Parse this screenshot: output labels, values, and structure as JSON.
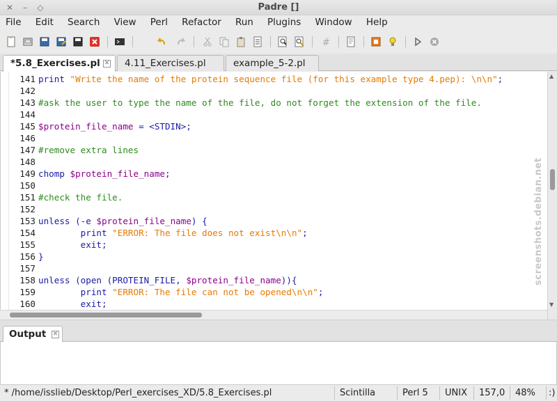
{
  "window": {
    "title": "Padre []",
    "close_glyph": "✕",
    "minimize_glyph": "–",
    "maximize_glyph": "◇"
  },
  "menu": [
    "File",
    "Edit",
    "Search",
    "View",
    "Perl",
    "Refactor",
    "Run",
    "Plugins",
    "Window",
    "Help"
  ],
  "toolbar": {
    "icons": [
      "new-file-icon",
      "open-file-icon",
      "save-icon",
      "save-as-icon",
      "save-all-icon",
      "close-file-icon",
      "command-line-icon",
      "undo-icon",
      "redo-icon",
      "cut-icon",
      "copy-icon",
      "paste-icon",
      "select-all-icon",
      "find-icon",
      "find-replace-icon",
      "comment-icon",
      "doc-stats-icon",
      "open-resource-icon",
      "tip-icon",
      "run-icon",
      "stop-icon"
    ]
  },
  "tabs": [
    {
      "label": "*5.8_Exercises.pl",
      "active": true
    },
    {
      "label": "4.11_Exercises.pl",
      "active": false
    },
    {
      "label": "example_5-2.pl",
      "active": false
    }
  ],
  "editor": {
    "lines": [
      {
        "n": "141",
        "tokens": [
          [
            "kw",
            "print "
          ],
          [
            "str",
            "\"Write the name of the protein sequence file (for this example type 4.pep): \\n\\n\""
          ],
          [
            "pl",
            ";"
          ]
        ]
      },
      {
        "n": "142",
        "tokens": []
      },
      {
        "n": "143",
        "tokens": [
          [
            "cmt",
            "#ask the user to type the name of the file, do not forget the extension of the file."
          ]
        ]
      },
      {
        "n": "144",
        "tokens": []
      },
      {
        "n": "145",
        "tokens": [
          [
            "var",
            "$protein_file_name"
          ],
          [
            "pl",
            " = <STDIN>;"
          ]
        ]
      },
      {
        "n": "146",
        "tokens": []
      },
      {
        "n": "147",
        "tokens": [
          [
            "cmt",
            "#remove extra lines"
          ]
        ]
      },
      {
        "n": "148",
        "tokens": []
      },
      {
        "n": "149",
        "tokens": [
          [
            "kw",
            "chomp "
          ],
          [
            "var",
            "$protein_file_name"
          ],
          [
            "pl",
            ";"
          ]
        ]
      },
      {
        "n": "150",
        "tokens": []
      },
      {
        "n": "151",
        "tokens": [
          [
            "cmt",
            "#check the file."
          ]
        ]
      },
      {
        "n": "152",
        "tokens": []
      },
      {
        "n": "153",
        "tokens": [
          [
            "kw",
            "unless "
          ],
          [
            "pl",
            "(-e "
          ],
          [
            "var",
            "$protein_file_name"
          ],
          [
            "pl",
            ") {"
          ]
        ]
      },
      {
        "n": "154",
        "tokens": [
          [
            "kw",
            "        print "
          ],
          [
            "str",
            "\"ERROR: The file does not exist\\n\\n\""
          ],
          [
            "pl",
            ";"
          ]
        ]
      },
      {
        "n": "155",
        "tokens": [
          [
            "kw",
            "        exit"
          ],
          [
            "pl",
            ";"
          ]
        ]
      },
      {
        "n": "156",
        "tokens": [
          [
            "pl",
            "}"
          ]
        ]
      },
      {
        "n": "157",
        "tokens": []
      },
      {
        "n": "158",
        "tokens": [
          [
            "kw",
            "unless "
          ],
          [
            "pl",
            "(open (PROTEIN_FILE, "
          ],
          [
            "var",
            "$protein_file_name"
          ],
          [
            "pl",
            ")){"
          ]
        ]
      },
      {
        "n": "159",
        "tokens": [
          [
            "kw",
            "        print "
          ],
          [
            "str",
            "\"ERROR: The file can not be opened\\n\\n\""
          ],
          [
            "pl",
            ";"
          ]
        ]
      },
      {
        "n": "160",
        "tokens": [
          [
            "kw",
            "        exit"
          ],
          [
            "pl",
            ";"
          ]
        ]
      }
    ]
  },
  "watermark": "screenshots.debian.net",
  "output": {
    "tab_label": "Output"
  },
  "status": {
    "file": "* /home/isslieb/Desktop/Perl_exercises_XD/5.8_Exercises.pl",
    "lexer": "Scintilla",
    "language": "Perl 5",
    "newline": "UNIX",
    "position": "157,0",
    "percent": "48%",
    "extra": ":)"
  },
  "colors": {
    "keyword": "#1a1aa6",
    "string": "#e67a00",
    "variable": "#8b008b",
    "comment": "#2e8b1e"
  }
}
